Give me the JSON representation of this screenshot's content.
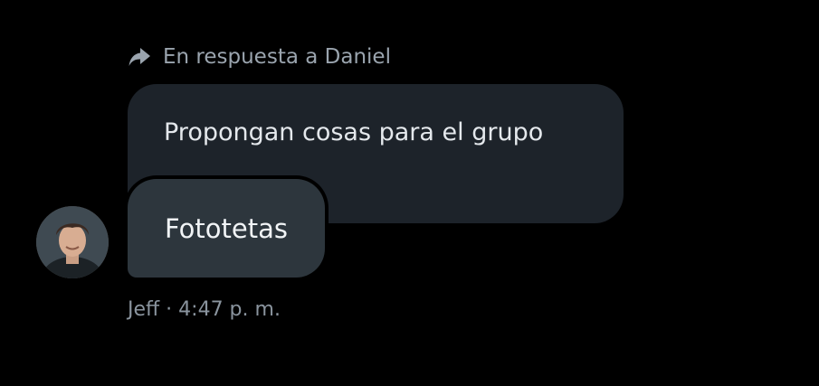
{
  "reply_context": {
    "icon": "reply-arrow-icon",
    "text": "En respuesta a Daniel"
  },
  "quoted_message": {
    "text": "Propongan cosas para el grupo"
  },
  "message": {
    "text": "Fototetas",
    "avatar": "user-avatar"
  },
  "meta": {
    "text": "Jeff · 4:47 p. m."
  },
  "colors": {
    "background": "#000000",
    "quoted_bubble": "#1d232a",
    "message_bubble": "#2d363d",
    "secondary_text": "#9aa4ae"
  }
}
